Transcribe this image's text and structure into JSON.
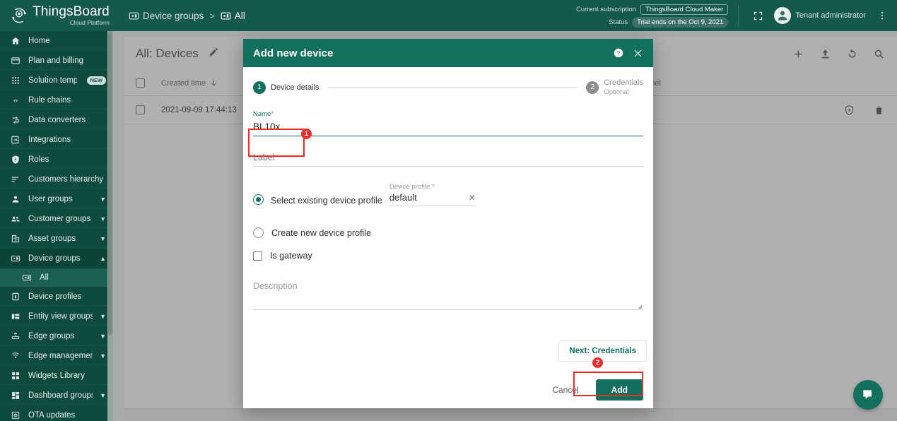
{
  "brand": {
    "name": "ThingsBoard",
    "subtitle": "Cloud Platform",
    "accent": "#14705e",
    "sidebar_bg": "#0f4a3e",
    "topbar_bg": "#15584c"
  },
  "topbar": {
    "breadcrumb": [
      {
        "label": "Device groups",
        "icon": "device-group-icon"
      },
      {
        "label": "All",
        "icon": "device-group-icon"
      }
    ],
    "separator": ">",
    "subscription_label": "Current subscription",
    "subscription_value": "ThingsBoard Cloud Maker",
    "status_label": "Status",
    "status_value": "Trial ends on the Oct 9, 2021",
    "fullscreen_icon": "fullscreen-icon",
    "user_name": "Tenant administrator",
    "menu_icon": "more-vertical-icon"
  },
  "sidebar": {
    "items": [
      {
        "label": "Home",
        "icon": "home-icon",
        "expandable": false
      },
      {
        "label": "Plan and billing",
        "icon": "billing-icon",
        "expandable": false
      },
      {
        "label": "Solution templates",
        "icon": "grid-icon",
        "expandable": false,
        "badge": "NEW"
      },
      {
        "label": "Rule chains",
        "icon": "rule-chain-icon",
        "expandable": false
      },
      {
        "label": "Data converters",
        "icon": "converter-icon",
        "expandable": false
      },
      {
        "label": "Integrations",
        "icon": "integration-icon",
        "expandable": false
      },
      {
        "label": "Roles",
        "icon": "shield-icon",
        "expandable": false
      },
      {
        "label": "Customers hierarchy",
        "icon": "hierarchy-icon",
        "expandable": false
      },
      {
        "label": "User groups",
        "icon": "user-icon",
        "expandable": true,
        "state": "collapsed"
      },
      {
        "label": "Customer groups",
        "icon": "customers-icon",
        "expandable": true,
        "state": "collapsed"
      },
      {
        "label": "Asset groups",
        "icon": "asset-icon",
        "expandable": true,
        "state": "collapsed"
      },
      {
        "label": "Device groups",
        "icon": "device-group-icon",
        "expandable": true,
        "state": "expanded"
      },
      {
        "label": "All",
        "icon": "device-group-icon",
        "expandable": false,
        "sub": true,
        "active": true
      },
      {
        "label": "Device profiles",
        "icon": "device-profile-icon",
        "expandable": false
      },
      {
        "label": "Entity view groups",
        "icon": "entity-view-icon",
        "expandable": true,
        "state": "collapsed"
      },
      {
        "label": "Edge groups",
        "icon": "edge-icon",
        "expandable": true,
        "state": "collapsed"
      },
      {
        "label": "Edge management",
        "icon": "edge-management-icon",
        "expandable": true,
        "state": "collapsed"
      },
      {
        "label": "Widgets Library",
        "icon": "widgets-icon",
        "expandable": false
      },
      {
        "label": "Dashboard groups",
        "icon": "dashboard-icon",
        "expandable": true,
        "state": "collapsed"
      },
      {
        "label": "OTA updates",
        "icon": "ota-icon",
        "expandable": false
      }
    ]
  },
  "content": {
    "title": "All: Devices",
    "edit_icon": "pencil-icon",
    "actions": [
      {
        "icon": "plus-icon",
        "name": "add-device-button"
      },
      {
        "icon": "import-icon",
        "name": "import-devices-button"
      },
      {
        "icon": "refresh-icon",
        "name": "refresh-button"
      },
      {
        "icon": "search-icon",
        "name": "search-button"
      }
    ],
    "table": {
      "columns": [
        "Created time",
        "Label"
      ],
      "sort_icon": "arrow-down-icon",
      "rows": [
        {
          "created_time": "2021-09-09 17:44:13",
          "label": ""
        }
      ],
      "row_actions": [
        {
          "icon": "shield-icon",
          "name": "manage-credentials-button"
        },
        {
          "icon": "trash-icon",
          "name": "delete-device-button"
        }
      ]
    }
  },
  "dialog": {
    "title": "Add new device",
    "help_icon": "help-icon",
    "close_icon": "close-icon",
    "steps": [
      {
        "num": "1",
        "label": "Device details",
        "sub": "",
        "state": "active"
      },
      {
        "num": "2",
        "label": "Credentials",
        "sub": "Optional",
        "state": "inactive"
      }
    ],
    "fields": {
      "name_label": "Name",
      "name_required": "*",
      "name_value": "BL10x",
      "label_label": "Label",
      "label_value": "",
      "radio_existing": "Select existing device profile",
      "radio_new": "Create new device profile",
      "device_profile_label": "Device profile",
      "device_profile_required": "*",
      "device_profile_value": "default",
      "clear_icon": "clear-x-icon",
      "gateway_checkbox": "Is gateway",
      "description_label": "Description",
      "description_value": ""
    },
    "buttons": {
      "next": "Next: Credentials",
      "cancel": "Cancel",
      "add": "Add"
    }
  },
  "annotations": [
    {
      "id": "1",
      "target": "name-field",
      "color": "#f4291f"
    },
    {
      "id": "2",
      "target": "next-credentials-button",
      "color": "#f4291f"
    }
  ],
  "chat": {
    "icon": "chat-bubble-icon",
    "color": "#14705e"
  }
}
